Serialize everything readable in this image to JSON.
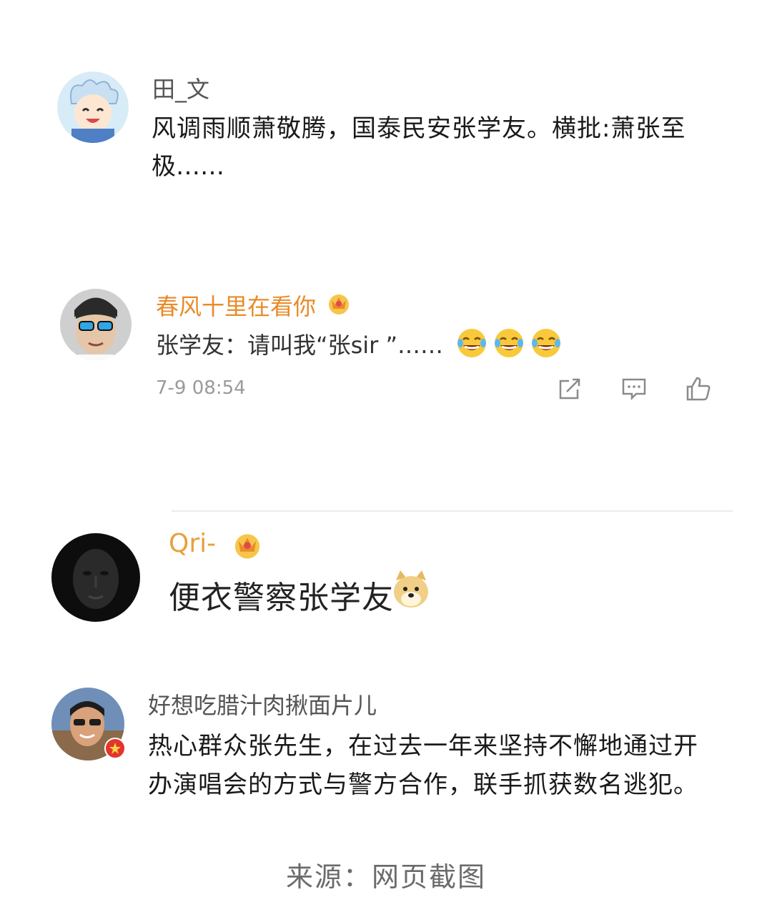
{
  "comments": [
    {
      "username": "田_文",
      "lines": [
        "风调雨顺萧敬腾，国泰民安张学友。横批:萧张至",
        "极……"
      ]
    },
    {
      "username": "春风十里在看你",
      "text": "张学友：请叫我“张sir ”……",
      "time": "7-9 08:54"
    },
    {
      "username": "Qri-",
      "text": "便衣警察张学友"
    },
    {
      "username": "好想吃腊汁肉揪面片儿",
      "lines": [
        "热心群众张先生，在过去一年来坚持不懈地通过开",
        "办演唱会的方式与警方合作，联手抓获数名逃犯。"
      ]
    }
  ],
  "footer": {
    "source": "来源：网页截图"
  },
  "icons": {
    "share": "share-icon",
    "comment": "comment-icon",
    "like": "thumbs-up-icon",
    "crown": "crown-badge-icon",
    "laugh": "laugh-cry-emoji",
    "doge": "doge-emoji",
    "verified": "verified-badge-icon"
  },
  "colors": {
    "vip_name": "#e98b2a",
    "text": "#1a1a1a",
    "meta": "#9a9a9a"
  }
}
